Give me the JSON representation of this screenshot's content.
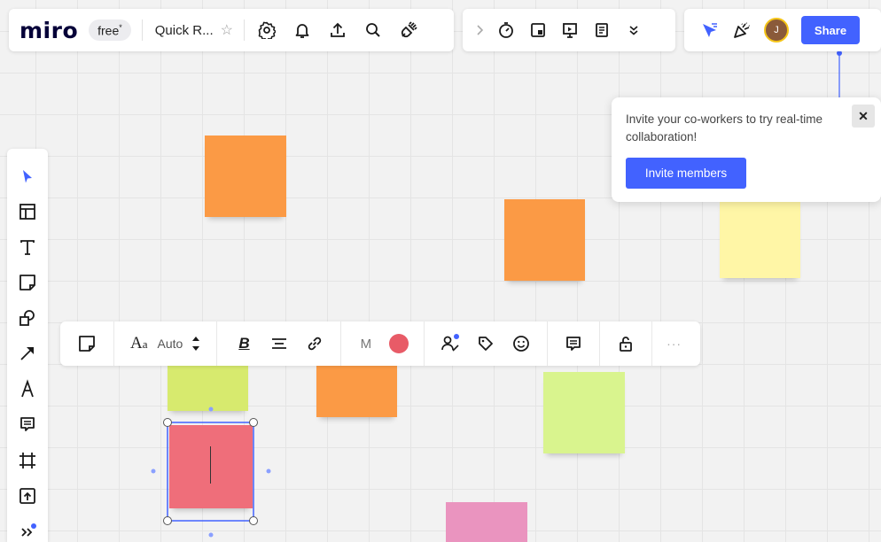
{
  "app": {
    "logo": "miro",
    "plan_badge": "free",
    "plan_badge_mark": "*",
    "board_title": "Quick R..."
  },
  "header": {
    "share_label": "Share",
    "avatar_initial": "J"
  },
  "context_toolbar": {
    "font_size": "Auto",
    "font_label_a": "A",
    "font_label_b": "a",
    "bold": "B",
    "marker": "M",
    "more": "···",
    "sticky_color": "#e85b67"
  },
  "popup": {
    "message": "Invite your co-workers to try real-time collaboration!",
    "button": "Invite members",
    "close": "✕"
  },
  "icons": {
    "top_left": [
      "settings-icon",
      "bell-icon",
      "upload-icon",
      "search-icon",
      "plug-icon"
    ],
    "top_mid": [
      "chevron-right-icon",
      "timer-icon",
      "board-card-icon",
      "presentation-icon",
      "notes-icon",
      "double-chevron-down-icon"
    ],
    "top_right": [
      "cursor-flag-icon",
      "celebrate-icon"
    ],
    "left_toolbar": [
      "cursor-icon",
      "templates-icon",
      "text-icon",
      "sticky-note-icon",
      "shapes-icon",
      "arrow-icon",
      "pen-icon",
      "comment-icon",
      "frame-icon",
      "upload-icon",
      "more-tools-icon"
    ]
  },
  "colors": {
    "accent": "#4262ff",
    "sticky_orange": "#fb9a45",
    "sticky_yellow": "#fff6a6",
    "sticky_green": "#d7f08a",
    "sticky_red": "#ef6e7a",
    "sticky_pink": "#ea94bf"
  }
}
